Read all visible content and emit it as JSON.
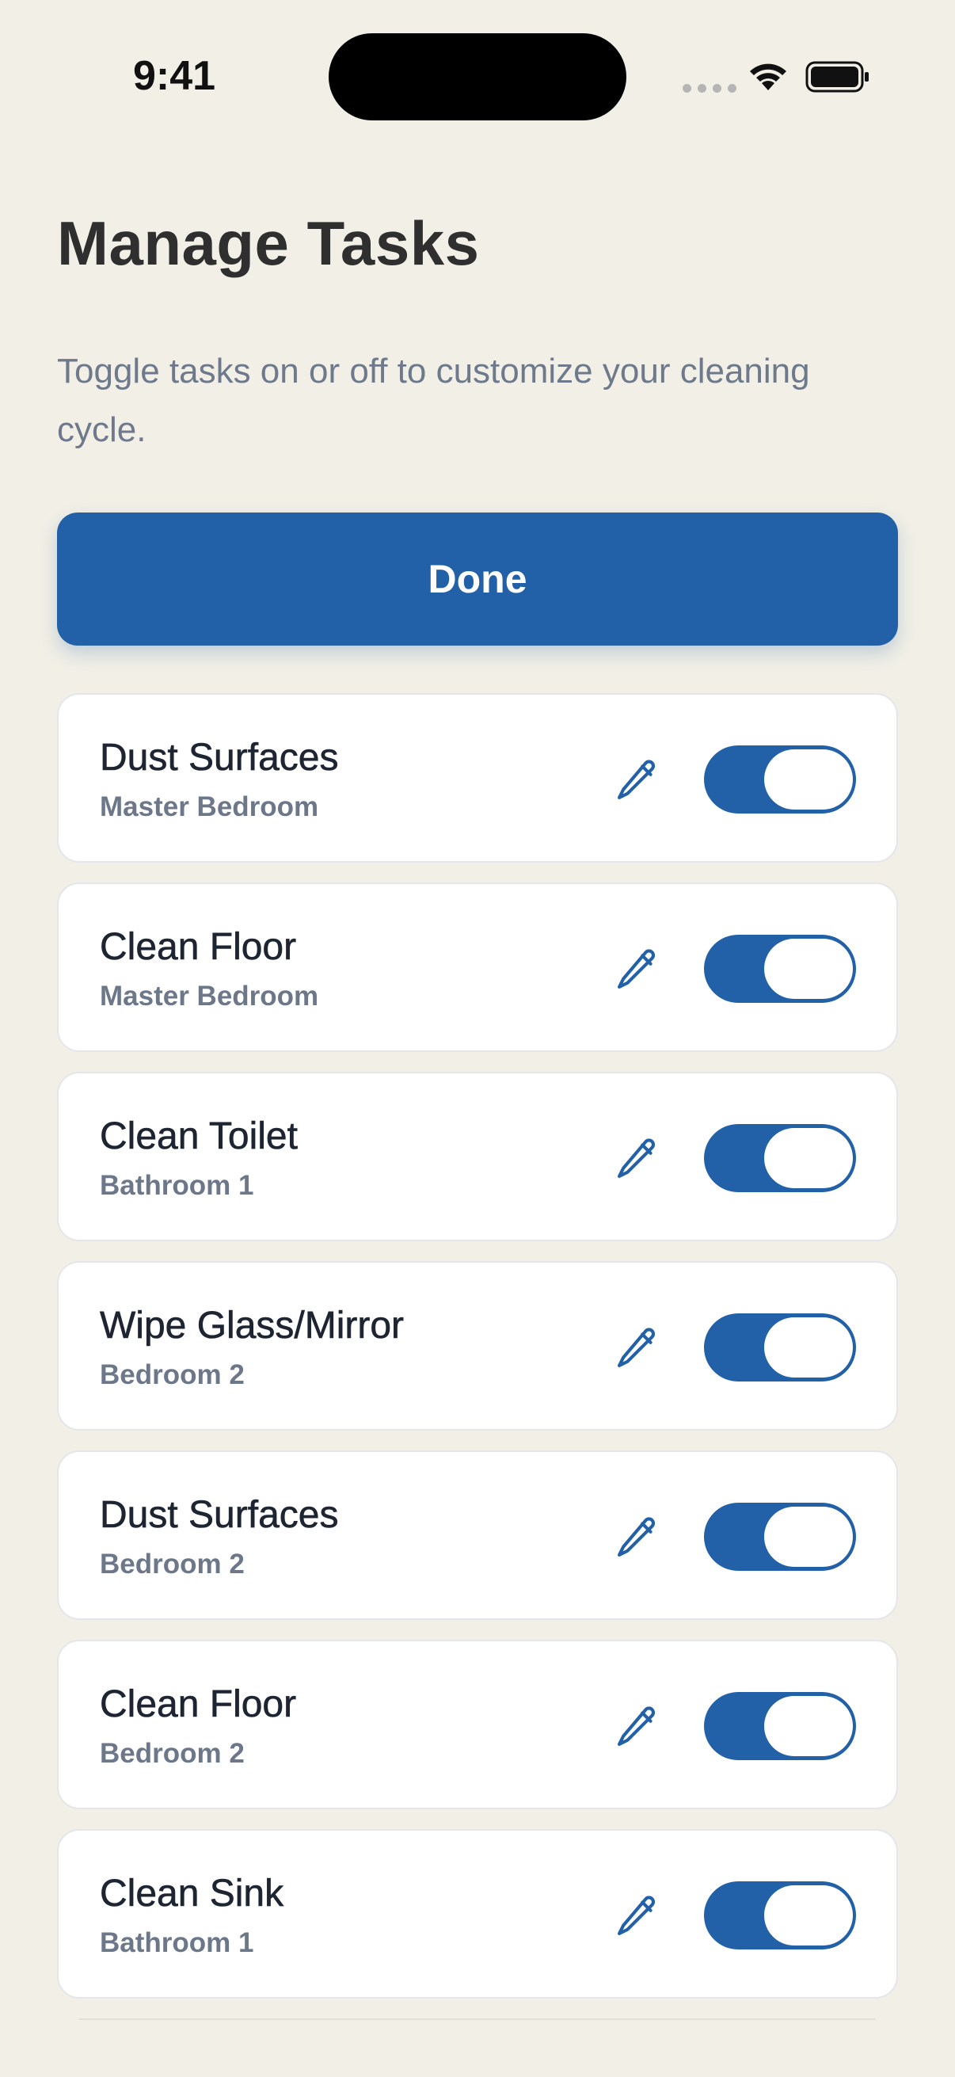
{
  "status_bar": {
    "time": "9:41"
  },
  "header": {
    "title": "Manage Tasks",
    "subtitle": "Toggle tasks on or off to customize your cleaning cycle."
  },
  "done_button": {
    "label": "Done"
  },
  "tasks": [
    {
      "name": "Dust Surfaces",
      "room": "Master Bedroom",
      "enabled": true
    },
    {
      "name": "Clean Floor",
      "room": "Master Bedroom",
      "enabled": true
    },
    {
      "name": "Clean Toilet",
      "room": "Bathroom 1",
      "enabled": true
    },
    {
      "name": "Wipe Glass/Mirror",
      "room": "Bedroom 2",
      "enabled": true
    },
    {
      "name": "Dust Surfaces",
      "room": "Bedroom 2",
      "enabled": true
    },
    {
      "name": "Clean Floor",
      "room": "Bedroom 2",
      "enabled": true
    },
    {
      "name": "Clean Sink",
      "room": "Bathroom 1",
      "enabled": true
    }
  ],
  "icons": {
    "edit": "pencil-icon",
    "wifi": "wifi-icon",
    "battery": "battery-icon"
  },
  "colors": {
    "accent": "#2261A8",
    "background": "#F1EFE6",
    "card": "#FFFFFF",
    "secondary_text": "#6C7789"
  }
}
